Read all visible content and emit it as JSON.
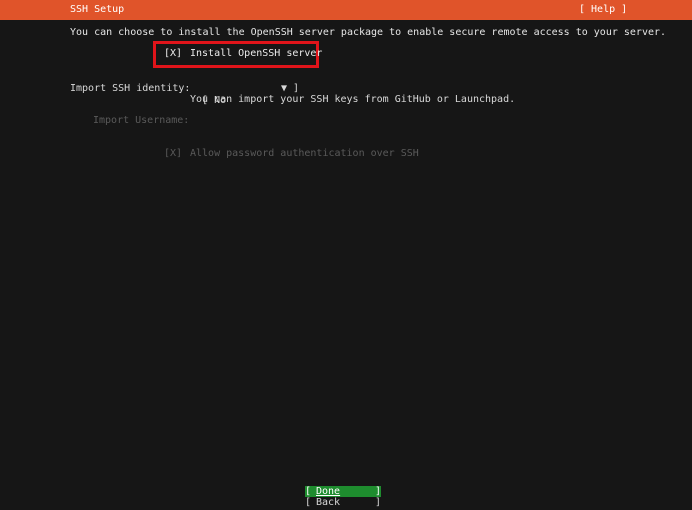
{
  "header": {
    "title": "SSH Setup",
    "help": "[ Help ]"
  },
  "intro": "You can choose to install the OpenSSH server package to enable secure remote access to your server.",
  "install_openssh": {
    "checkbox": "[X]",
    "label": "Install OpenSSH server"
  },
  "import_ssh": {
    "label": "Import SSH identity:",
    "bracket_open": "[ No",
    "arrow": "▼",
    "bracket_close": "]",
    "help": "You can import your SSH keys from GitHub or Launchpad."
  },
  "import_username": {
    "label": "Import Username:"
  },
  "allow_password": {
    "checkbox": "[X]",
    "label": "Allow password authentication over SSH"
  },
  "buttons": {
    "open": "[",
    "close": "]",
    "done": "Done",
    "back": "Back"
  },
  "colors": {
    "header": "#e0542a",
    "highlight": "#e0141a",
    "done_button": "#1e8c2e",
    "background": "#161616"
  }
}
